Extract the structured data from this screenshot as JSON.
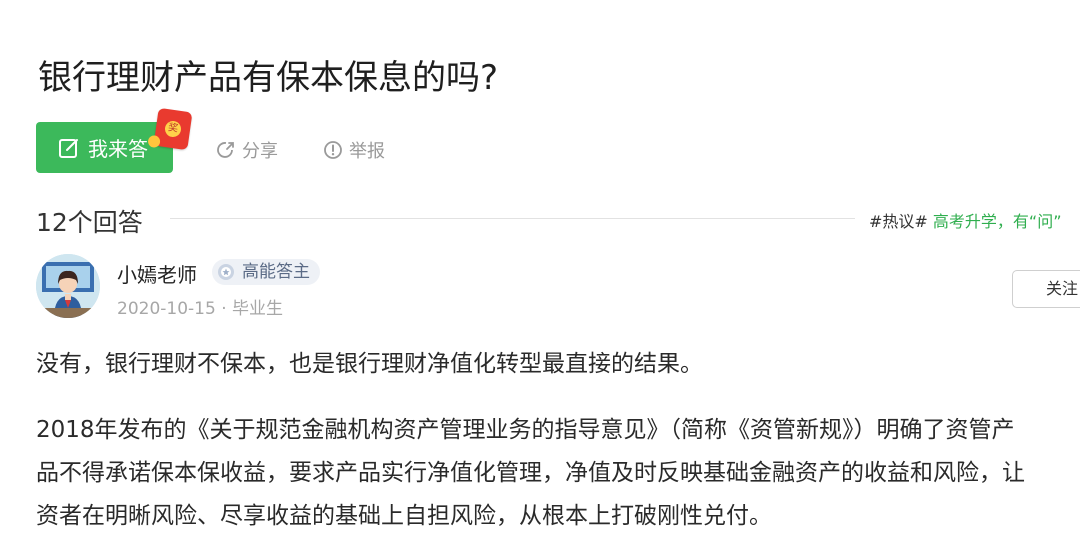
{
  "question": {
    "title": "银行理财产品有保本保息的吗?"
  },
  "actions": {
    "answer_label": "我来答",
    "redpacket_char": "奖",
    "share_label": "分享",
    "report_label": "举报"
  },
  "answers_header": {
    "count_label": "12个回答",
    "hot_tag": "#热议#",
    "hot_topic": " 高考升学，有“问”"
  },
  "answer": {
    "author": "小嫣老师",
    "badge": "高能答主",
    "date": "2020-10-15",
    "separator": " · ",
    "role": "毕业生",
    "follow_label": "关注",
    "paragraphs": [
      "没有，银行理财不保本，也是银行理财净值化转型最直接的结果。",
      "2018年发布的《关于规范金融机构资产管理业务的指导意见》（简称《资管新规》）明确了资管产",
      "品不得承诺保本保收益，要求产品实行净值化管理，净值及时反映基础金融资产的收益和风险，让",
      "资者在明晰风险、尽享收益的基础上自担风险，从根本上打破刚性兑付。"
    ]
  },
  "colors": {
    "accent_green": "#3cb95b",
    "badge_text": "#5b6b86",
    "muted": "#9a9a9a"
  },
  "icons": [
    "edit-icon",
    "share-icon",
    "report-icon",
    "medal-icon",
    "redpacket-icon"
  ]
}
